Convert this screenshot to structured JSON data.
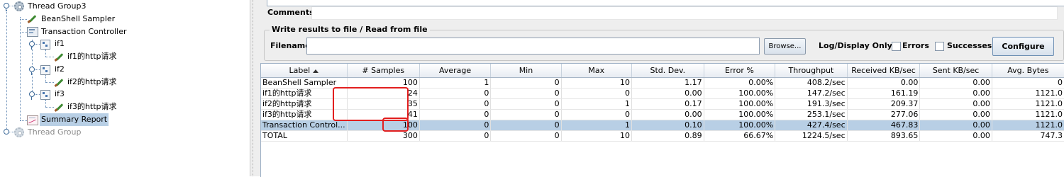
{
  "tree": {
    "nodes": [
      {
        "label": "Thread Group3"
      },
      {
        "label": "BeanShell Sampler"
      },
      {
        "label": "Transaction Controller"
      },
      {
        "label": "if1"
      },
      {
        "label": "if1的http请求"
      },
      {
        "label": "if2"
      },
      {
        "label": "if2的http请求"
      },
      {
        "label": "if3"
      },
      {
        "label": "if3的http请求"
      },
      {
        "label": "Summary Report"
      },
      {
        "label": "Thread Group"
      }
    ]
  },
  "panel": {
    "comments_label": "Comments:",
    "file_group_title": "Write results to file / Read from file",
    "filename_label": "Filename",
    "filename_value": "",
    "browse_label": "Browse...",
    "log_display_label": "Log/Display Only:",
    "errors_label": "Errors",
    "successes_label": "Successes",
    "configure_label": "Configure"
  },
  "table": {
    "headers": [
      "Label",
      "# Samples",
      "Average",
      "Min",
      "Max",
      "Std. Dev.",
      "Error %",
      "Throughput",
      "Received KB/sec",
      "Sent KB/sec",
      "Avg. Bytes"
    ],
    "sorted_column": "Label",
    "rows": [
      [
        "BeanShell Sampler",
        "100",
        "1",
        "0",
        "10",
        "1.17",
        "0.00%",
        "408.2/sec",
        "0.00",
        "0.00",
        "0"
      ],
      [
        "if1的http请求",
        "24",
        "0",
        "0",
        "0",
        "0.00",
        "100.00%",
        "147.2/sec",
        "161.19",
        "0.00",
        "1121.0"
      ],
      [
        "if2的http请求",
        "35",
        "0",
        "0",
        "1",
        "0.17",
        "100.00%",
        "191.3/sec",
        "209.37",
        "0.00",
        "1121.0"
      ],
      [
        "if3的http请求",
        "41",
        "0",
        "0",
        "0",
        "0.00",
        "100.00%",
        "253.1/sec",
        "277.06",
        "0.00",
        "1121.0"
      ],
      [
        "Transaction Control...",
        "100",
        "0",
        "0",
        "1",
        "0.10",
        "100.00%",
        "427.4/sec",
        "467.83",
        "0.00",
        "1121.0"
      ],
      [
        "TOTAL",
        "300",
        "0",
        "0",
        "10",
        "0.89",
        "66.67%",
        "1224.5/sec",
        "893.65",
        "0.00",
        "747.3"
      ]
    ],
    "selected_row": 4
  },
  "colors": {
    "selection": "#b8cfe5",
    "highlight_box": "#e21f1f",
    "panel_bg": "#eeeeee"
  }
}
